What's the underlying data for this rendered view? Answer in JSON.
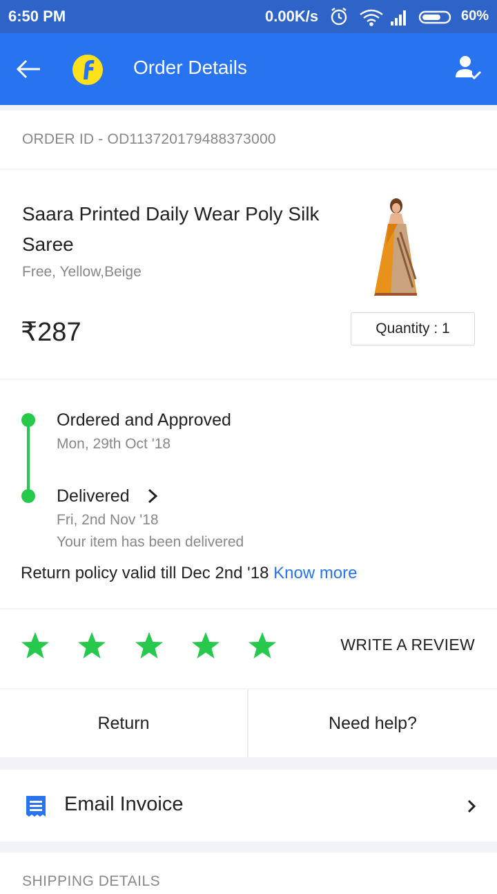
{
  "status_bar": {
    "time": "6:50 PM",
    "network_speed": "0.00K/s",
    "battery": "60%",
    "icons": [
      "alarm-icon",
      "wifi-icon",
      "signal-icon",
      "battery-icon"
    ]
  },
  "app_bar": {
    "title": "Order Details",
    "back_icon": "back-arrow-icon",
    "logo_icon": "flipkart-logo",
    "account_icon": "account-check-icon",
    "color": "#2874f0"
  },
  "order": {
    "id_text": "ORDER ID - OD113720179488373000"
  },
  "product": {
    "name": "Saara Printed Daily Wear Poly Silk Saree",
    "variant": "Free, Yellow,Beige",
    "price": "₹287",
    "quantity": "Quantity : 1"
  },
  "tracking": {
    "steps": [
      {
        "title": "Ordered and Approved",
        "date": "Mon, 29th Oct '18"
      },
      {
        "title": "Delivered",
        "date": "Fri, 2nd Nov '18",
        "note": "Your item has been delivered"
      }
    ],
    "return_policy": "Return policy valid till Dec 2nd '18",
    "know_more": "Know more",
    "status_color": "#26c94b"
  },
  "rating": {
    "stars": 5,
    "star_color": "#26c94b",
    "write_review": "WRITE A REVIEW"
  },
  "actions": {
    "return_label": "Return",
    "help_label": "Need help?"
  },
  "invoice": {
    "label": "Email Invoice"
  },
  "shipping": {
    "heading": "SHIPPING DETAILS"
  }
}
